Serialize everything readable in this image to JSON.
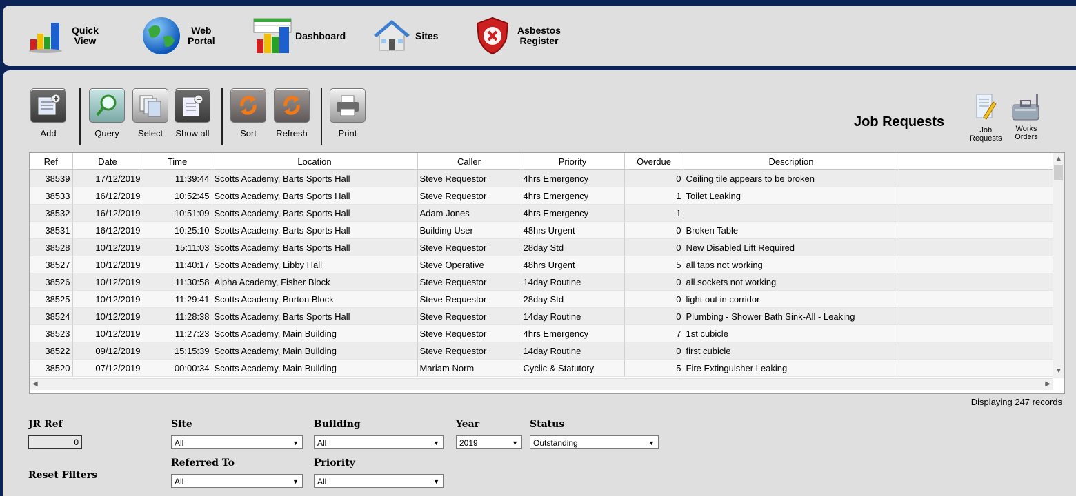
{
  "nav": {
    "items": [
      {
        "label": "Quick\nView",
        "icon": "bar-chart-icon"
      },
      {
        "label": "Web\nPortal",
        "icon": "globe-icon"
      },
      {
        "label": "Dashboard",
        "icon": "dashboard-chart-icon"
      },
      {
        "label": "Sites",
        "icon": "house-icon"
      },
      {
        "label": "Asbestos\nRegister",
        "icon": "warning-shield-icon"
      }
    ]
  },
  "toolbar": {
    "add": "Add",
    "query": "Query",
    "select": "Select",
    "show_all": "Show all",
    "sort": "Sort",
    "refresh": "Refresh",
    "print": "Print"
  },
  "page_title": "Job Requests",
  "side_buttons": {
    "job_requests": "Job\nRequests",
    "works_orders": "Works\nOrders"
  },
  "table": {
    "columns": [
      "Ref",
      "Date",
      "Time",
      "Location",
      "Caller",
      "Priority",
      "Overdue",
      "Description"
    ],
    "rows": [
      [
        "38539",
        "17/12/2019",
        "11:39:44",
        "Scotts Academy, Barts Sports Hall",
        "Steve Requestor",
        "4hrs Emergency",
        "0",
        "Ceiling tile appears to be broken"
      ],
      [
        "38533",
        "16/12/2019",
        "10:52:45",
        "Scotts Academy, Barts Sports Hall",
        "Steve Requestor",
        "4hrs Emergency",
        "1",
        "Toilet Leaking"
      ],
      [
        "38532",
        "16/12/2019",
        "10:51:09",
        "Scotts Academy, Barts Sports Hall",
        "Adam Jones",
        "4hrs Emergency",
        "1",
        ""
      ],
      [
        "38531",
        "16/12/2019",
        "10:25:10",
        "Scotts Academy, Barts Sports Hall",
        "Building User",
        "48hrs Urgent",
        "0",
        "Broken Table"
      ],
      [
        "38528",
        "10/12/2019",
        "15:11:03",
        "Scotts Academy, Barts Sports Hall",
        "Steve Requestor",
        "28day Std",
        "0",
        "New Disabled Lift Required"
      ],
      [
        "38527",
        "10/12/2019",
        "11:40:17",
        "Scotts Academy, Libby Hall",
        "Steve Operative",
        "48hrs Urgent",
        "5",
        "all taps not working"
      ],
      [
        "38526",
        "10/12/2019",
        "11:30:58",
        "Alpha Academy, Fisher Block",
        "Steve Requestor",
        "14day Routine",
        "0",
        "all sockets not working"
      ],
      [
        "38525",
        "10/12/2019",
        "11:29:41",
        "Scotts Academy, Burton Block",
        "Steve Requestor",
        "28day Std",
        "0",
        "light out in corridor"
      ],
      [
        "38524",
        "10/12/2019",
        "11:28:38",
        "Scotts Academy, Barts Sports Hall",
        "Steve Requestor",
        "14day Routine",
        "0",
        "Plumbing - Shower Bath Sink-All - Leaking"
      ],
      [
        "38523",
        "10/12/2019",
        "11:27:23",
        "Scotts Academy, Main Building",
        "Steve Requestor",
        "4hrs Emergency",
        "7",
        "1st cubicle"
      ],
      [
        "38522",
        "09/12/2019",
        "15:15:39",
        "Scotts Academy, Main Building",
        "Steve Requestor",
        "14day Routine",
        "0",
        "first cubicle"
      ],
      [
        "38520",
        "07/12/2019",
        "00:00:34",
        "Scotts Academy, Main Building",
        "Mariam Norm",
        "Cyclic & Statutory",
        "5",
        "Fire Extinguisher Leaking"
      ]
    ]
  },
  "records_text": "Displaying 247 records",
  "filters": {
    "jr_ref_label": "JR Ref",
    "jr_ref_value": "0",
    "site_label": "Site",
    "site_value": "All",
    "building_label": "Building",
    "building_value": "All",
    "year_label": "Year",
    "year_value": "2019",
    "status_label": "Status",
    "status_value": "Outstanding",
    "referred_label": "Referred To",
    "referred_value": "All",
    "priority_label": "Priority",
    "priority_value": "All",
    "reset_label": "Reset Filters"
  }
}
